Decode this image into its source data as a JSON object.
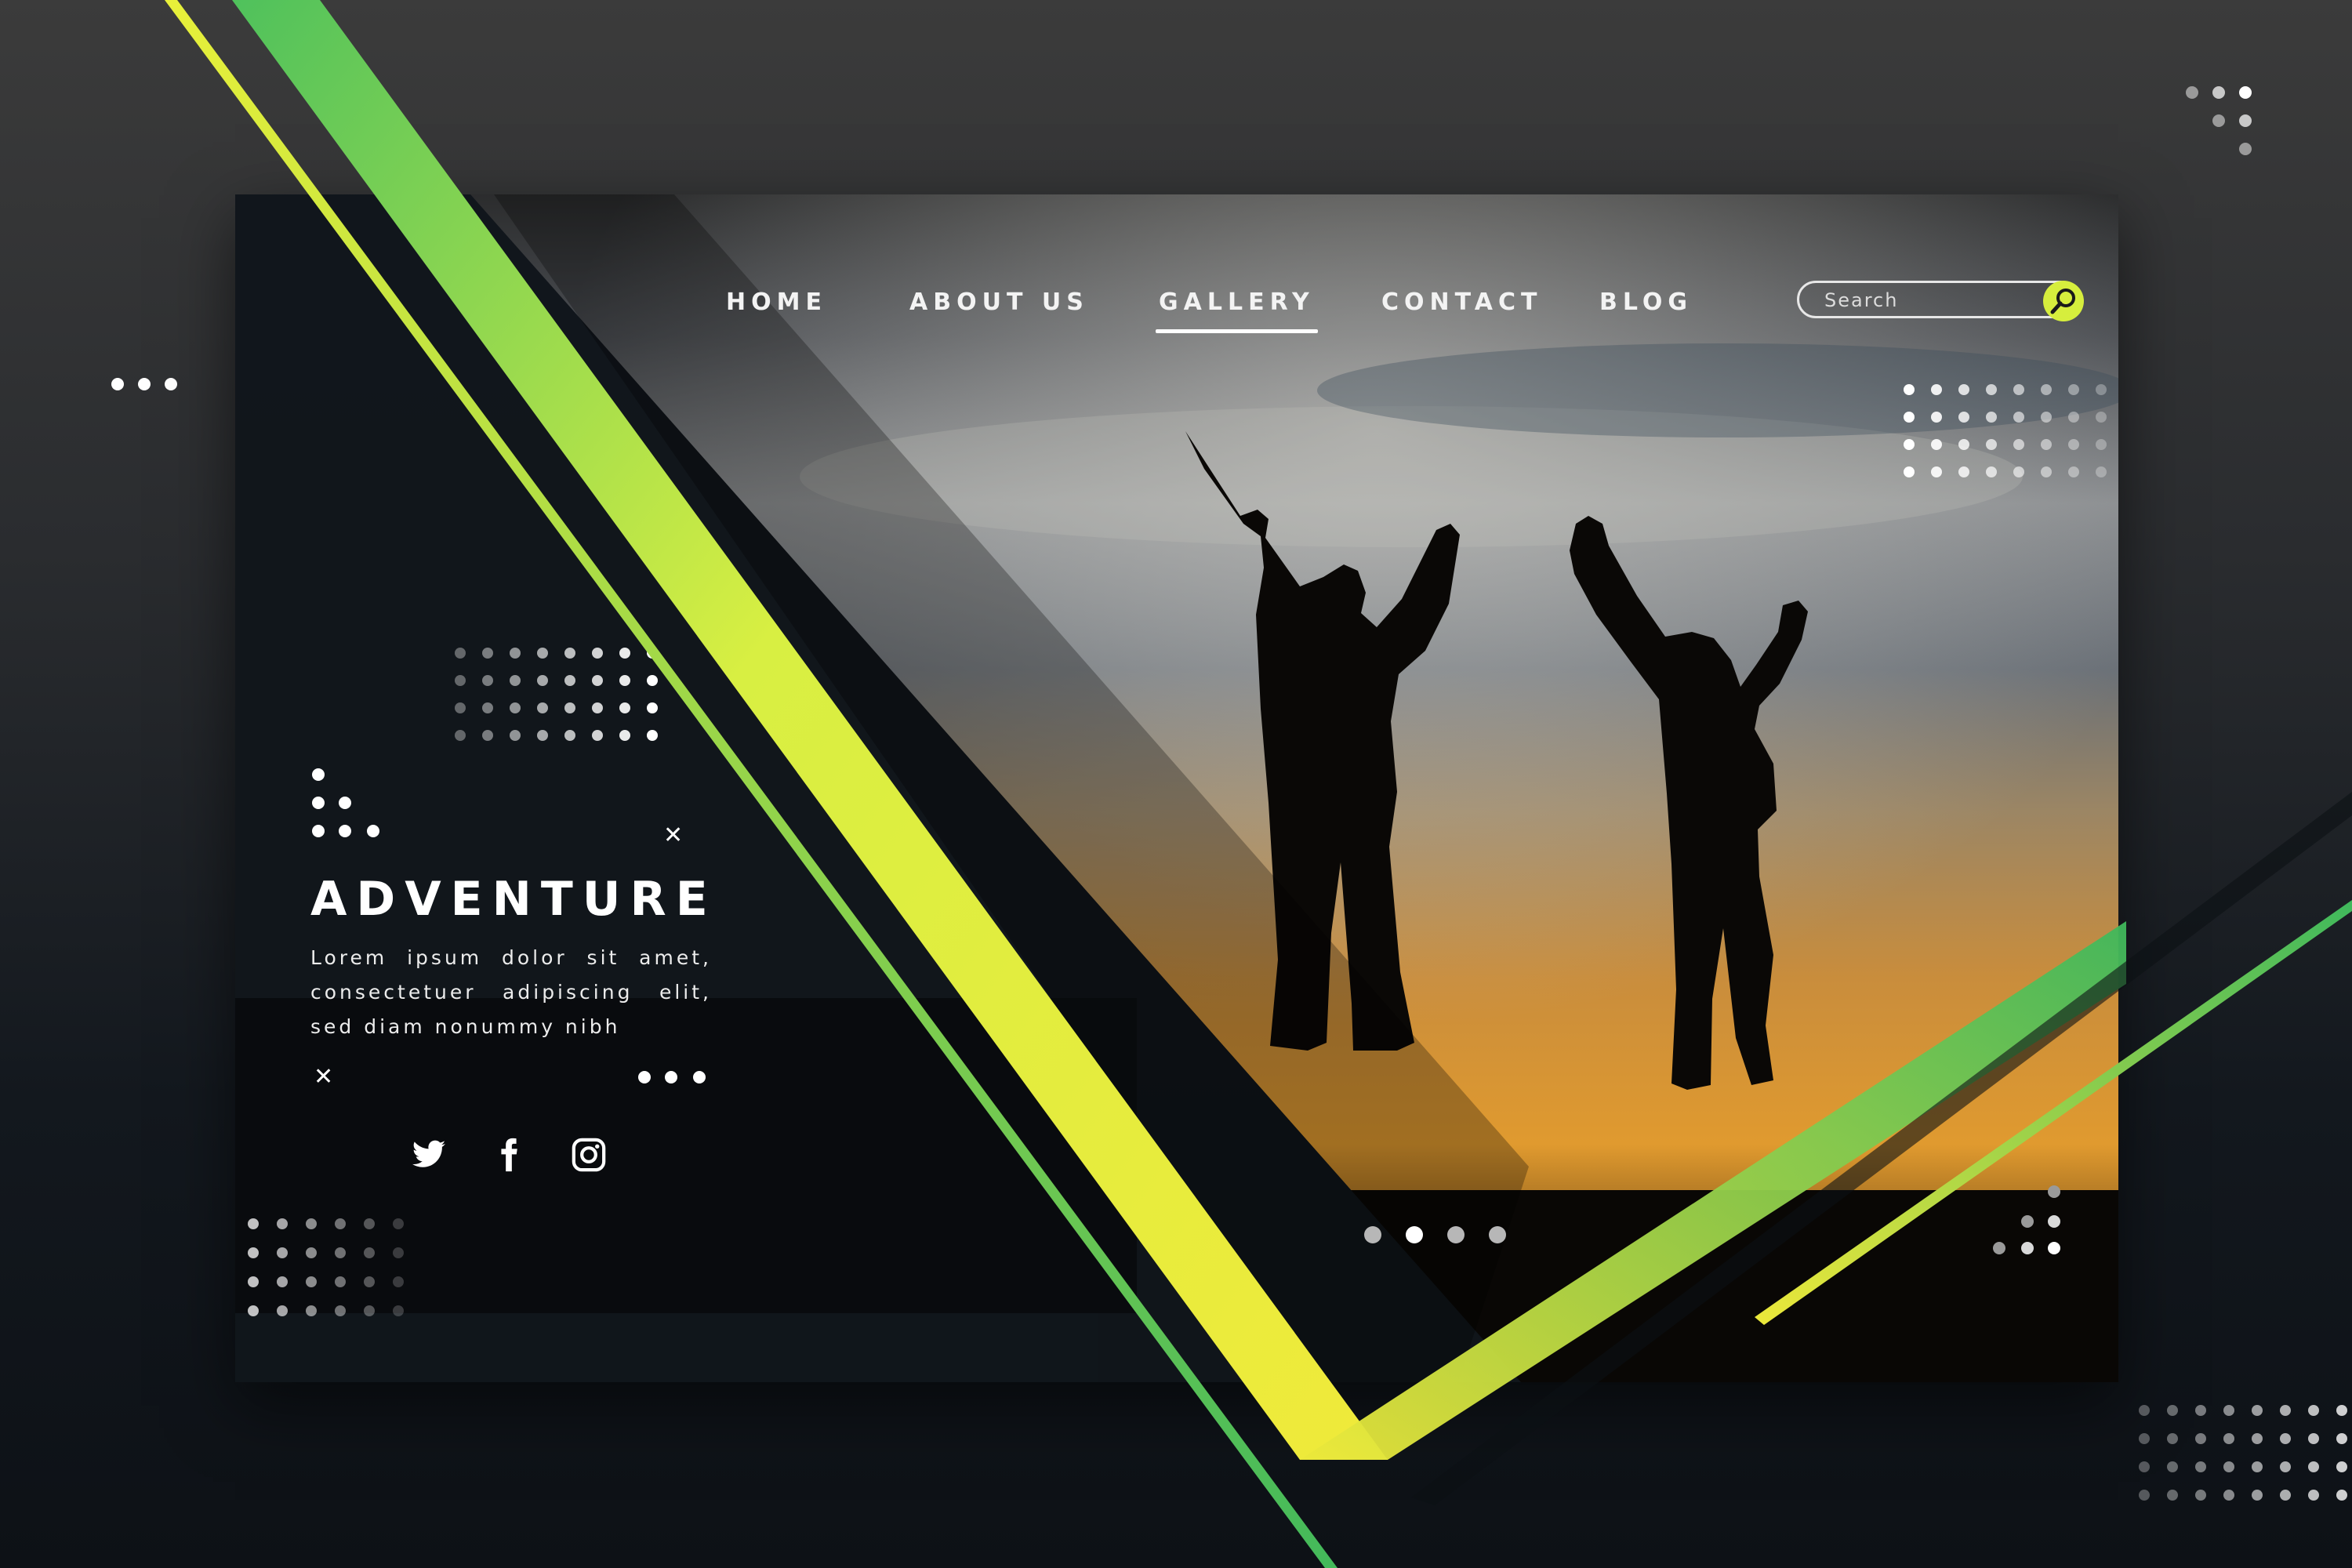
{
  "nav": {
    "items": [
      {
        "label": "HOME",
        "active": false
      },
      {
        "label": "ABOUT US",
        "active": false
      },
      {
        "label": "GALLERY",
        "active": true
      },
      {
        "label": "CONTACT",
        "active": false
      },
      {
        "label": "BLOG",
        "active": false
      }
    ]
  },
  "search": {
    "placeholder": "Search",
    "icon": "search-icon"
  },
  "hero": {
    "title": "ADVENTURE",
    "description": "Lorem ipsum dolor sit amet, consectetuer adipiscing elit, sed diam nonummy nibh"
  },
  "social": {
    "icons": [
      "twitter-icon",
      "facebook-icon",
      "instagram-icon"
    ]
  },
  "slider": {
    "total": 4,
    "active_index": 2
  },
  "colors": {
    "accent_yellow": "#e6f03c",
    "accent_green": "#4fc15c",
    "background_dark": "#13181e"
  }
}
